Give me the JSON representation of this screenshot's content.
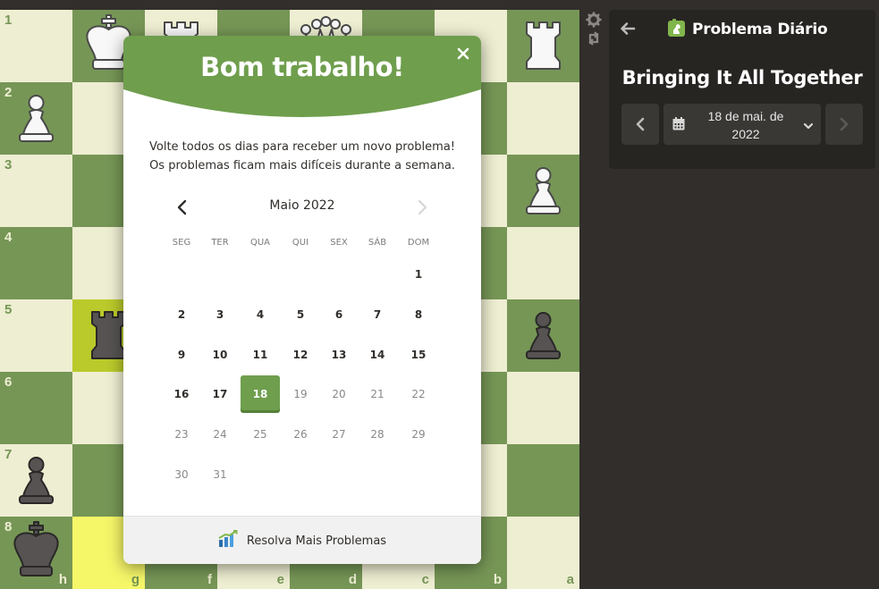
{
  "colors": {
    "board_light": "#eeeed2",
    "board_dark": "#769656",
    "highlight_light": "#f6f669",
    "highlight_dark": "#baca2b",
    "accent_green": "#6f9e4d",
    "panel_bg": "#272522",
    "page_bg": "#312e2b"
  },
  "board": {
    "orientation": "black",
    "rank_labels": [
      "1",
      "2",
      "3",
      "4",
      "5",
      "6",
      "7",
      "8"
    ],
    "file_labels": [
      "h",
      "g",
      "f",
      "e",
      "d",
      "c",
      "b",
      "a"
    ],
    "highlighted_squares": [
      "g5",
      "g8"
    ],
    "visible_pieces": [
      {
        "square": "g1",
        "piece": "white-king"
      },
      {
        "square": "f1",
        "piece": "white-rook"
      },
      {
        "square": "d1",
        "piece": "white-queen"
      },
      {
        "square": "a1",
        "piece": "white-rook"
      },
      {
        "square": "h2",
        "piece": "white-pawn"
      },
      {
        "square": "a3",
        "piece": "white-pawn"
      },
      {
        "square": "g5",
        "piece": "black-rook"
      },
      {
        "square": "a5",
        "piece": "black-pawn"
      },
      {
        "square": "h7",
        "piece": "black-pawn"
      },
      {
        "square": "h8",
        "piece": "black-king"
      }
    ],
    "controls": [
      {
        "icon": "gear-icon"
      },
      {
        "icon": "flip-board-icon"
      }
    ]
  },
  "panel": {
    "title": "Problema Diário",
    "title_icon": "puzzle-knight-icon",
    "puzzle_name": "Bringing It All Together",
    "date_line1": "18 de mai. de",
    "date_line2": "2022"
  },
  "modal": {
    "title": "Bom trabalho!",
    "description_line1": "Volte todos os dias para receber um novo problema!",
    "description_line2": "Os problemas ficam mais difíceis durante a semana.",
    "calendar": {
      "month_label": "Maio 2022",
      "weekdays": [
        "SEG",
        "TER",
        "QUA",
        "QUI",
        "SEX",
        "SÁB",
        "DOM"
      ],
      "first_weekday_index": 6,
      "days_in_month": 31,
      "selected_day": 18,
      "today": 18,
      "days": [
        "1",
        "2",
        "3",
        "4",
        "5",
        "6",
        "7",
        "8",
        "9",
        "10",
        "11",
        "12",
        "13",
        "14",
        "15",
        "16",
        "17",
        "18",
        "19",
        "20",
        "21",
        "22",
        "23",
        "24",
        "25",
        "26",
        "27",
        "28",
        "29",
        "30",
        "31"
      ]
    },
    "footer_label": "Resolva Mais Problemas",
    "footer_icon": "bar-chart-icon"
  }
}
